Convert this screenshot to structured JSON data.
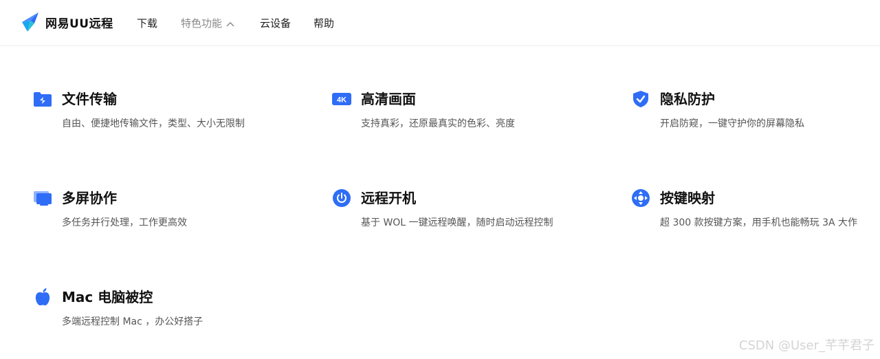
{
  "brand": {
    "name": "网易UU远程"
  },
  "nav": {
    "items": [
      {
        "label": "下载"
      },
      {
        "label": "特色功能"
      },
      {
        "label": "云设备"
      },
      {
        "label": "帮助"
      }
    ]
  },
  "features": [
    {
      "icon": "folder-transfer-icon",
      "title": "文件传输",
      "desc": "自由、便捷地传输文件，类型、大小无限制"
    },
    {
      "icon": "4k-badge-icon",
      "badge": "4K",
      "title": "高清画面",
      "desc": "支持真彩，还原最真实的色彩、亮度"
    },
    {
      "icon": "shield-check-icon",
      "title": "隐私防护",
      "desc": "开启防窥，一键守护你的屏幕隐私"
    },
    {
      "icon": "multi-screen-icon",
      "title": "多屏协作",
      "desc": "多任务并行处理，工作更高效"
    },
    {
      "icon": "power-icon",
      "title": "远程开机",
      "desc": "基于 WOL 一键远程唤醒，随时启动远程控制"
    },
    {
      "icon": "keymap-icon",
      "title": "按键映射",
      "desc": "超 300 款按键方案，用手机也能畅玩 3A 大作"
    },
    {
      "icon": "apple-icon",
      "title": "Mac 电脑被控",
      "desc": "多端远程控制 Mac ，办公好搭子"
    }
  ],
  "watermark": "CSDN @User_芊芊君子",
  "colors": {
    "accent": "#2f6df6",
    "text": "#1f1f1f",
    "muted": "#8a8a8a"
  }
}
